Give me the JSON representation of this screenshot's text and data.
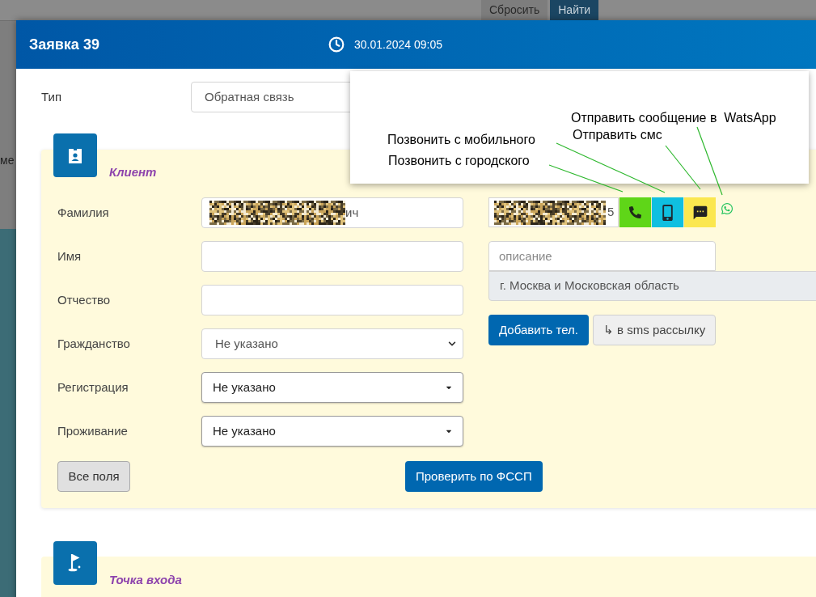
{
  "background": {
    "buttons": [
      {
        "label": "Сбросить",
        "selected": false
      },
      {
        "label": "Найти",
        "selected": true
      }
    ],
    "table_fragment": "ме"
  },
  "window": {
    "title": "Заявка 39",
    "datetime": "30.01.2024 09:05"
  },
  "type_field": {
    "label": "Тип",
    "value": "Обратная связь"
  },
  "client": {
    "title": "Клиент",
    "fields": [
      {
        "label": "Фамилия",
        "kind": "text",
        "value": "ич",
        "redacted": true
      },
      {
        "label": "Имя",
        "kind": "text"
      },
      {
        "label": "Отчество",
        "kind": "text"
      },
      {
        "label": "Гражданство",
        "kind": "select",
        "value": "Не указано"
      },
      {
        "label": "Регистрация",
        "kind": "dropdown",
        "value": "Не указано"
      },
      {
        "label": "Проживание",
        "kind": "dropdown",
        "value": "Не указано"
      }
    ],
    "phone": {
      "value": "5",
      "redacted": true,
      "actions": [
        {
          "kind": "landline"
        },
        {
          "kind": "mobile"
        },
        {
          "kind": "sms"
        },
        {
          "kind": "whatsapp"
        }
      ]
    },
    "description_placeholder": "описание",
    "region": "г. Москва и Московская область",
    "add_phone_button": "Добавить тел.",
    "sms_list_button": "↳ в sms рассылку",
    "all_fields_button": "Все поля",
    "check_button": "Проверить по ФССП"
  },
  "entry_point": {
    "title": "Точка входа"
  },
  "annotations": [
    {
      "text": "Отправить сообщение в  WatsApp"
    },
    {
      "text": "Позвонить с мобильного"
    },
    {
      "text": "Отправить смс"
    },
    {
      "text": "Позвонить с городского"
    }
  ]
}
